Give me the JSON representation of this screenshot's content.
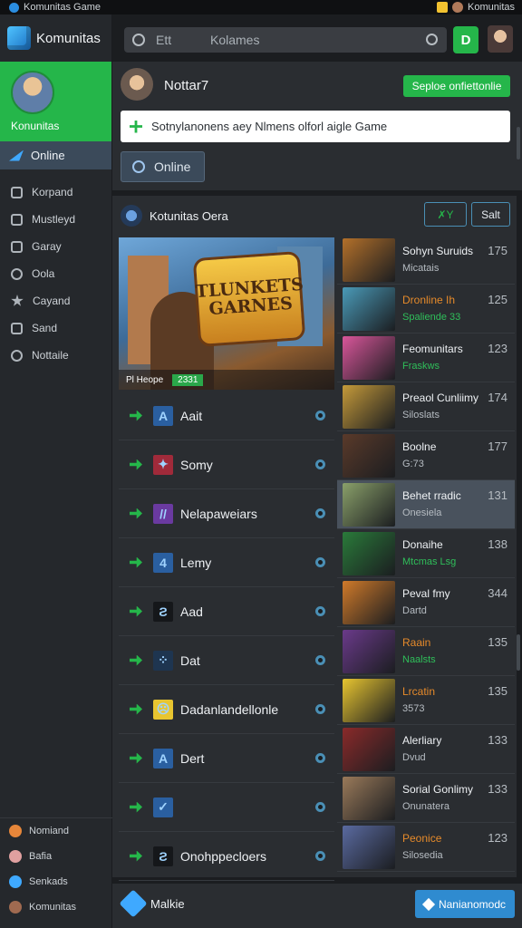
{
  "window": {
    "title": "Komunitas Game",
    "account_name": "Komunitas"
  },
  "sidebar": {
    "brand": "Komunitas",
    "profile_name": "Konunitas",
    "active_item": "Online",
    "items": [
      {
        "label": "Korpand",
        "icon": "controller-icon"
      },
      {
        "label": "Mustleyd",
        "icon": "chat-icon"
      },
      {
        "label": "Garay",
        "icon": "gamepad-icon"
      },
      {
        "label": "Oola",
        "icon": "at-icon"
      },
      {
        "label": "Cayand",
        "icon": "star-icon"
      },
      {
        "label": "Sand",
        "icon": "bag-icon"
      },
      {
        "label": "Nottaile",
        "icon": "bell-icon"
      }
    ],
    "bottom_items": [
      {
        "label": "Nomiand",
        "icon": "orange-dot-icon",
        "color": "#e6863a"
      },
      {
        "label": "Bafia",
        "icon": "person-icon",
        "color": "#e0a0a0"
      },
      {
        "label": "Senkads",
        "icon": "shield-icon",
        "color": "#3fa9ff"
      },
      {
        "label": "Komunitas",
        "icon": "avatar-icon",
        "color": "#a06a50"
      }
    ]
  },
  "header": {
    "search_left": "Ett",
    "search_value": "Kolames",
    "go_label": "D"
  },
  "post": {
    "name": "Nottar7",
    "cta": "Seploe onfiettonlie",
    "compose_text": "Sotnylanonens aey Nlmens olforl aigle Game",
    "online_button": "Online"
  },
  "panel": {
    "title": "Kotunitas Oera",
    "btn1": "✗Y",
    "btn2": "Salt",
    "hero": {
      "title_line1": "TLUNKETS",
      "title_line2": "GARNES",
      "caption": "Pl Heope",
      "tag": "2331"
    }
  },
  "friends": [
    {
      "name": "Aait",
      "icon_text": "A",
      "icon_color": "#2a5fa0"
    },
    {
      "name": "Somy",
      "icon_text": "✦",
      "icon_color": "#a02a3a"
    },
    {
      "name": "Nelapaweiars",
      "icon_text": "//",
      "icon_color": "#6a3aa0"
    },
    {
      "name": "Lemy",
      "icon_text": "4",
      "icon_color": "#2a5fa0"
    },
    {
      "name": "Aad",
      "icon_text": "Ƨ",
      "icon_color": "#15171a"
    },
    {
      "name": "Dat",
      "icon_text": "⁘",
      "icon_color": "#1e3550"
    },
    {
      "name": "Dadanlandellonle",
      "icon_text": "☹",
      "icon_color": "#e8c530"
    },
    {
      "name": "Dert",
      "icon_text": "A",
      "icon_color": "#2a5fa0"
    },
    {
      "name": "",
      "icon_text": "✓",
      "icon_color": "#2a5fa0"
    },
    {
      "name": "Onohppecloers",
      "icon_text": "Ƨ",
      "icon_color": "#15171a"
    }
  ],
  "games": [
    {
      "title": "Sohyn Suruids",
      "sub": "Micatais",
      "count": "175",
      "thumb": "#b3702a",
      "title_style": "",
      "sub_style": "",
      "selected": false
    },
    {
      "title": "Dronline Ih",
      "sub": "Spaliende 33",
      "count": "125",
      "thumb": "#4a9ab8",
      "title_style": "orange",
      "sub_style": "green",
      "selected": false
    },
    {
      "title": "Feomunitars",
      "sub": "Fraskws",
      "count": "123",
      "thumb": "#d9569a",
      "title_style": "",
      "sub_style": "green",
      "selected": false
    },
    {
      "title": "Preaol Cunliimy",
      "sub": "Siloslats",
      "count": "174",
      "thumb": "#c59a3a",
      "title_style": "",
      "sub_style": "",
      "selected": false
    },
    {
      "title": "Boolne",
      "sub": "G:73",
      "count": "177",
      "thumb": "#5a3a2a",
      "title_style": "",
      "sub_style": "",
      "selected": false
    },
    {
      "title": "Behet rradic",
      "sub": "Onesiela",
      "count": "131",
      "thumb": "#8aa06a",
      "title_style": "",
      "sub_style": "",
      "selected": true
    },
    {
      "title": "Donaihe",
      "sub": "Mtcmas Lsg",
      "count": "138",
      "thumb": "#2a7a3a",
      "title_style": "green",
      "sub_style": "green",
      "selected": false
    },
    {
      "title": "Peval fmy",
      "sub": "Dartd",
      "count": "344",
      "thumb": "#d07a2a",
      "title_style": "",
      "sub_style": "",
      "selected": false
    },
    {
      "title": "Raain",
      "sub": "Naalsts",
      "count": "135",
      "thumb": "#6a3a8a",
      "title_style": "orange",
      "sub_style": "green",
      "selected": false
    },
    {
      "title": "Lrcatin",
      "sub": "3573",
      "count": "135",
      "thumb": "#e8c530",
      "title_style": "orange",
      "sub_style": "",
      "selected": false
    },
    {
      "title": "Alerliary",
      "sub": "Dvud",
      "count": "133",
      "thumb": "#8a2a2a",
      "title_style": "",
      "sub_style": "",
      "selected": false
    },
    {
      "title": "Sorial Gonlimy",
      "sub": "Onunatera",
      "count": "133",
      "thumb": "#9a7a5a",
      "title_style": "",
      "sub_style": "",
      "selected": false
    },
    {
      "title": "Peonice",
      "sub": "Silosedia",
      "count": "123",
      "thumb": "#5a6aa0",
      "title_style": "orange",
      "sub_style": "",
      "selected": false
    }
  ],
  "bottom": {
    "left_label": "Malkie",
    "button_label": "Nanianomodc"
  }
}
